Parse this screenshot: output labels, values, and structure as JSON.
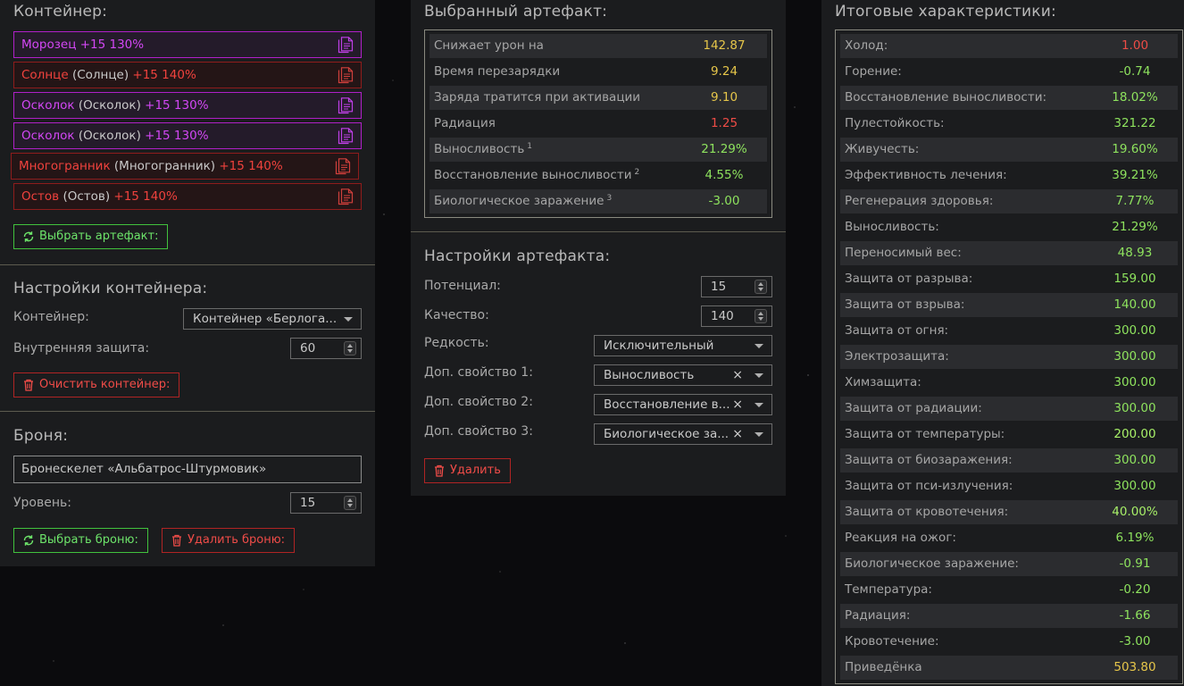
{
  "colors": {
    "green": "#6de46a",
    "red": "#f04c48",
    "purple": "#d347f5",
    "yellow": "#e6c64a"
  },
  "container": {
    "title": "Контейнер:",
    "slots": [
      {
        "name": "Морозец",
        "paren": "",
        "level": "+15 130%",
        "rarity": "purple"
      },
      {
        "name": "Солнце",
        "paren": "(Солнце)",
        "level": "+15 140%",
        "rarity": "red"
      },
      {
        "name": "Осколок",
        "paren": "(Осколок)",
        "level": "+15 130%",
        "rarity": "purple"
      },
      {
        "name": "Осколок",
        "paren": "(Осколок)",
        "level": "+15 130%",
        "rarity": "purple"
      },
      {
        "name": "Многогранник",
        "paren": "(Многогранник)",
        "level": "+15 140%",
        "rarity": "red"
      },
      {
        "name": "Остов",
        "paren": "(Остов)",
        "level": "+15 140%",
        "rarity": "red"
      }
    ],
    "select_button": "Выбрать артефакт:"
  },
  "container_settings": {
    "title": "Настройки контейнера:",
    "container_label": "Контейнер:",
    "container_value": "Контейнер «Берлога...",
    "protection_label": "Внутренняя защита:",
    "protection_value": "60",
    "clear_button": "Очистить контейнер:"
  },
  "armor": {
    "title": "Броня:",
    "armor_value": "Бронескелет «Альбатрос-Штурмовик»",
    "level_label": "Уровень:",
    "level_value": "15",
    "select_button": "Выбрать броню:",
    "delete_button": "Удалить броню:"
  },
  "selected_artifact": {
    "title": "Выбранный артефакт:",
    "stats": [
      {
        "key": "Снижает урон на",
        "sup": "",
        "value": "142.87",
        "color": "yellow"
      },
      {
        "key": "Время перезарядки",
        "sup": "",
        "value": "9.24",
        "color": "yellow"
      },
      {
        "key": "Заряда тратится при активации",
        "sup": "",
        "value": "9.10",
        "color": "yellow"
      },
      {
        "key": "Радиация",
        "sup": "",
        "value": "1.25",
        "color": "red"
      },
      {
        "key": "Выносливость",
        "sup": "1",
        "value": "21.29%",
        "color": "green"
      },
      {
        "key": "Восстановление выносливости",
        "sup": "2",
        "value": "4.55%",
        "color": "green"
      },
      {
        "key": "Биологическое заражение",
        "sup": "3",
        "value": "-3.00",
        "color": "green"
      }
    ]
  },
  "artifact_settings": {
    "title": "Настройки артефакта:",
    "potential_label": "Потенциал:",
    "potential_value": "15",
    "quality_label": "Качество:",
    "quality_value": "140",
    "rarity_label": "Редкость:",
    "rarity_value": "Исключительный",
    "extra1_label": "Доп. свойство 1:",
    "extra1_value": "Выносливость",
    "extra2_label": "Доп. свойство 2:",
    "extra2_value": "Восстановление в...",
    "extra3_label": "Доп. свойство 3:",
    "extra3_value": "Биологическое за...",
    "clear_symbol": "×",
    "delete_button": "Удалить"
  },
  "totals": {
    "title": "Итоговые характеристики:",
    "stats": [
      {
        "key": "Холод:",
        "value": "1.00",
        "color": "red"
      },
      {
        "key": "Горение:",
        "value": "-0.74",
        "color": "green"
      },
      {
        "key": "Восстановление выносливости:",
        "value": "18.02%",
        "color": "green"
      },
      {
        "key": "Пулестойкость:",
        "value": "321.22",
        "color": "green"
      },
      {
        "key": "Живучесть:",
        "value": "19.60%",
        "color": "green"
      },
      {
        "key": "Эффективность лечения:",
        "value": "39.21%",
        "color": "green"
      },
      {
        "key": "Регенерация здоровья:",
        "value": "7.77%",
        "color": "green"
      },
      {
        "key": "Выносливость:",
        "value": "21.29%",
        "color": "green"
      },
      {
        "key": "Переносимый вес:",
        "value": "48.93",
        "color": "green"
      },
      {
        "key": "Защита от разрыва:",
        "value": "159.00",
        "color": "green"
      },
      {
        "key": "Защита от взрыва:",
        "value": "140.00",
        "color": "green"
      },
      {
        "key": "Защита от огня:",
        "value": "300.00",
        "color": "green"
      },
      {
        "key": "Электрозащита:",
        "value": "300.00",
        "color": "green"
      },
      {
        "key": "Химзащита:",
        "value": "300.00",
        "color": "green"
      },
      {
        "key": "Защита от радиации:",
        "value": "300.00",
        "color": "green"
      },
      {
        "key": "Защита от температуры:",
        "value": "200.00",
        "color": "lgreen"
      },
      {
        "key": "Защита от биозаражения:",
        "value": "300.00",
        "color": "green"
      },
      {
        "key": "Защита от пси-излучения:",
        "value": "300.00",
        "color": "green"
      },
      {
        "key": "Защита от кровотечения:",
        "value": "40.00%",
        "color": "lgreen"
      },
      {
        "key": "Реакция на ожог:",
        "value": "6.19%",
        "color": "green"
      },
      {
        "key": "Биологическое заражение:",
        "value": "-0.91",
        "color": "green"
      },
      {
        "key": "Температура:",
        "value": "-0.20",
        "color": "green"
      },
      {
        "key": "Радиация:",
        "value": "-1.66",
        "color": "green"
      },
      {
        "key": "Кровотечение:",
        "value": "-3.00",
        "color": "green"
      },
      {
        "key": "Приведёнка",
        "value": "503.80",
        "color": "yellow"
      }
    ]
  }
}
